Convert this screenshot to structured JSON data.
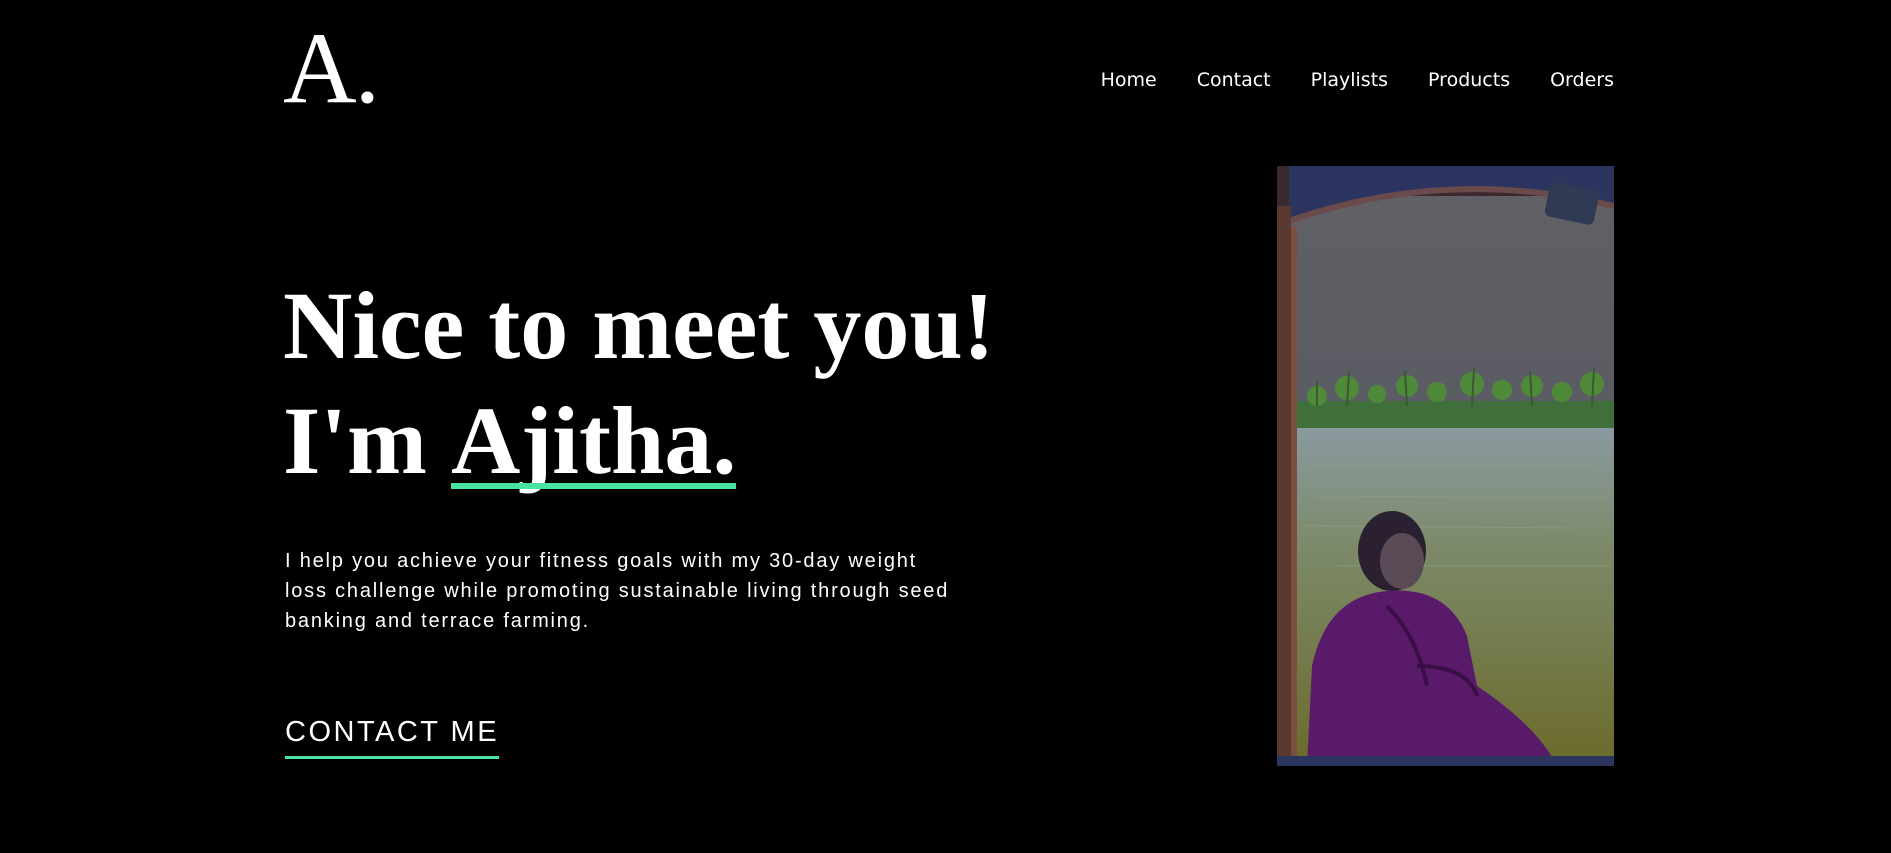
{
  "logo": {
    "text": "A."
  },
  "nav": {
    "items": [
      {
        "label": "Home"
      },
      {
        "label": "Contact"
      },
      {
        "label": "Playlists"
      },
      {
        "label": "Products"
      },
      {
        "label": "Orders"
      }
    ]
  },
  "hero": {
    "line1": "Nice to meet you!",
    "line2_prefix": "I'm",
    "name": "Ajitha.",
    "intro": "I help you achieve your fitness goals with my 30-day weight loss challenge while promoting sustainable living through seed banking and terrace farming.",
    "cta_label": "CONTACT ME"
  },
  "colors": {
    "background": "#000000",
    "text": "#ffffff",
    "accent": "#4be3a0"
  }
}
